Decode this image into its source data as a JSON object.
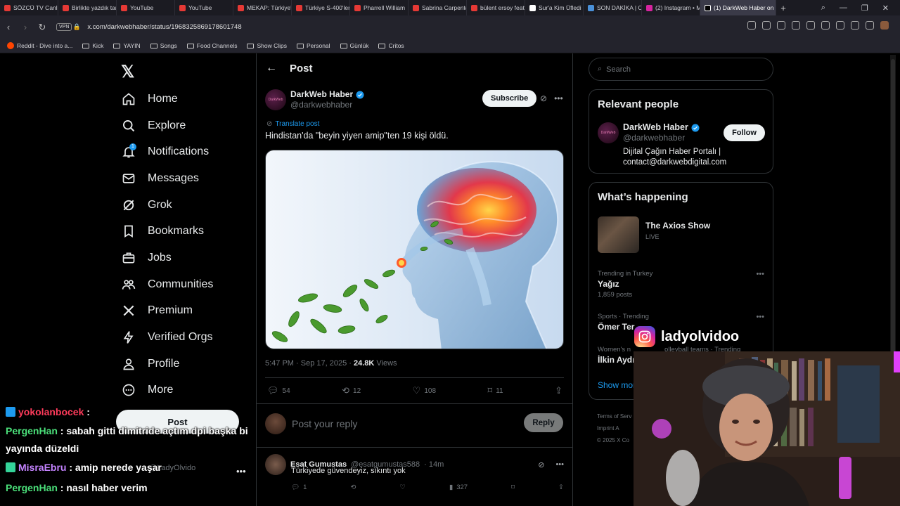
{
  "browser": {
    "tabs": [
      {
        "label": "SÖZCÜ TV Canlı",
        "color": "#e53935"
      },
      {
        "label": "Birlikte yazdık tar",
        "color": "#e53935"
      },
      {
        "label": "YouTube",
        "color": "#e53935"
      },
      {
        "label": "YouTube",
        "color": "#e53935"
      },
      {
        "label": "MEKAP: Türkiye'",
        "color": "#e53935"
      },
      {
        "label": "Türkiye S-400'ler",
        "color": "#e53935"
      },
      {
        "label": "Pharrell William",
        "color": "#e53935"
      },
      {
        "label": "Sabrina Carpente",
        "color": "#e53935"
      },
      {
        "label": "bülent ersoy feat",
        "color": "#e53935"
      },
      {
        "label": "Sur'a Kim Üfledi",
        "color": "#ffffff"
      },
      {
        "label": "SON DAKİKA | Cl",
        "color": "#4a90d9"
      },
      {
        "label": "(2) Instagram • M",
        "color": "#d6249f"
      }
    ],
    "active_tab": "(1) DarkWeb Haber on X:",
    "vpn_label": "VPN",
    "url": "x.com/darkwebhaber/status/1968325869178601748",
    "bookmarks": {
      "reddit": "Reddit - Dive into a...",
      "items": [
        "Kick",
        "YAYIN",
        "Songs",
        "Food Channels",
        "Show Clips",
        "Personal",
        "Günlük",
        "Critos"
      ]
    }
  },
  "nav": {
    "items": [
      {
        "label": "Home",
        "icon": "home-icon"
      },
      {
        "label": "Explore",
        "icon": "search-icon"
      },
      {
        "label": "Notifications",
        "icon": "bell-icon",
        "badge": "1"
      },
      {
        "label": "Messages",
        "icon": "mail-icon"
      },
      {
        "label": "Grok",
        "icon": "grok-icon"
      },
      {
        "label": "Bookmarks",
        "icon": "bookmark-icon"
      },
      {
        "label": "Jobs",
        "icon": "briefcase-icon"
      },
      {
        "label": "Communities",
        "icon": "people-icon"
      },
      {
        "label": "Premium",
        "icon": "x-logo-icon"
      },
      {
        "label": "Verified Orgs",
        "icon": "lightning-icon"
      },
      {
        "label": "Profile",
        "icon": "person-icon"
      },
      {
        "label": "More",
        "icon": "more-circle-icon"
      }
    ],
    "post_button": "Post",
    "mini_handle": "@LadyOlvido"
  },
  "post": {
    "header_title": "Post",
    "author_name": "DarkWeb Haber",
    "author_handle": "@darkwebhaber",
    "avatar_text": "DarkWeb",
    "subscribe": "Subscribe",
    "translate": "Translate post",
    "text": "Hindistan'da \"beyin yiyen amip\"ten 19 kişi öldü.",
    "time": "5:47 PM · Sep 17, 2025 · ",
    "views_count": "24.8K",
    "views_label": " Views",
    "replies": "54",
    "reposts": "12",
    "likes": "108",
    "bookmarks": "11",
    "reply_placeholder": "Post your reply",
    "reply_button": "Reply"
  },
  "comment": {
    "name": "Esat Gumustas",
    "handle": "@esatgumustas588",
    "time": "· 14m",
    "text": "Türkiyede güvendeyiz, sıkıntı yok",
    "replies": "1",
    "views": "327"
  },
  "right": {
    "search_placeholder": "Search",
    "relevant_title": "Relevant people",
    "rp_name": "DarkWeb Haber",
    "rp_handle": "@darkwebhaber",
    "rp_bio_1": "Dijital Çağın Haber Portalı |",
    "rp_bio_2": "contact@darkwebdigital.com",
    "follow": "Follow",
    "whats_title": "What’s happening",
    "show_title": "The Axios Show",
    "show_live": "LIVE",
    "trends": [
      {
        "meta": "Trending in Turkey",
        "title": "Yağız",
        "posts": "1,859 posts"
      },
      {
        "meta": "Sports · Trending",
        "title": "Ömer Ter",
        "posts": ""
      },
      {
        "meta": "Women's n",
        "title": "İlkin Aydı",
        "posts": "",
        "meta_tail": "olleyball teams · Trending"
      }
    ],
    "show_more": "Show mor",
    "footer_1": "Terms of Serv",
    "footer_2": "Imprint   A",
    "footer_3": "© 2025 X Co"
  },
  "overlay": {
    "ig_name": "ladyolvidoo",
    "chat": [
      {
        "user": "yokolanbocek",
        "msg": " : ",
        "cls": "u1",
        "badge": "#1d9bf0"
      },
      {
        "user": "PergenHan",
        "msg": " : sabah gitti dimitride açtım dpi başka bi yayında düzeldi",
        "cls": "u2",
        "badge": ""
      },
      {
        "user": "MisraEbru",
        "msg": " : amip nerede yaşar",
        "cls": "u3",
        "badge": "#34d399"
      },
      {
        "user": "PergenHan",
        "msg": " : nasıl haber verim",
        "cls": "u2",
        "badge": ""
      }
    ]
  },
  "colors": {
    "accent": "#1d9bf0",
    "background": "#000000",
    "border": "#2f3336"
  }
}
